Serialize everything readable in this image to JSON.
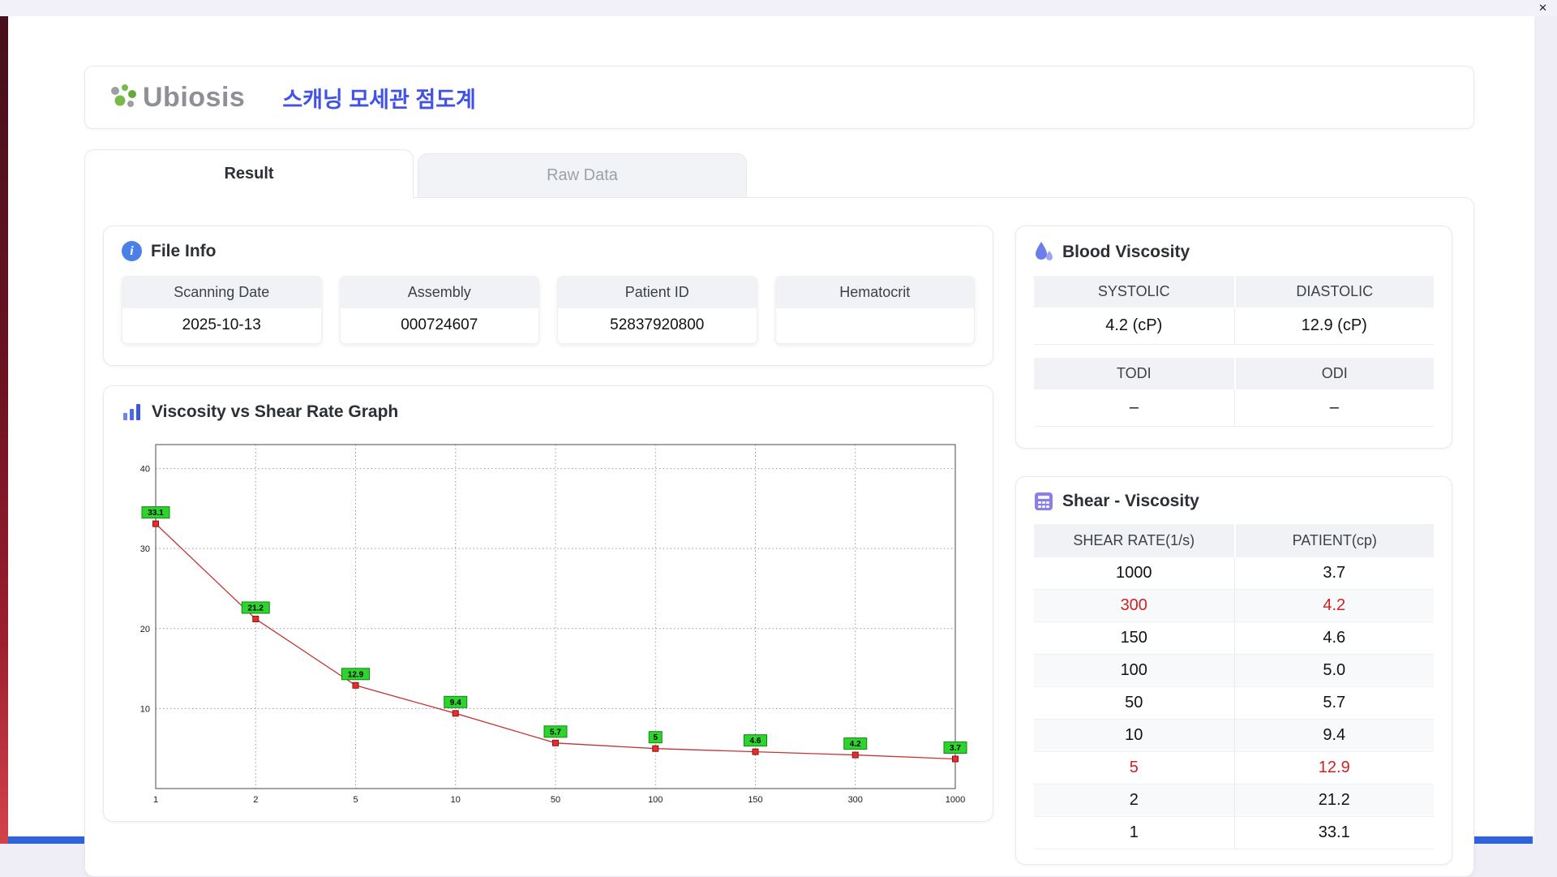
{
  "window": {
    "close_label": "✕"
  },
  "header": {
    "logo_text": "Ubiosis",
    "app_title": "스캐닝 모세관 점도계"
  },
  "tabs": {
    "result": "Result",
    "raw_data": "Raw Data"
  },
  "file_info": {
    "heading": "File Info",
    "fields": [
      {
        "label": "Scanning Date",
        "value": "2025-10-13"
      },
      {
        "label": "Assembly",
        "value": "000724607"
      },
      {
        "label": "Patient ID",
        "value": "52837920800"
      },
      {
        "label": "Hematocrit",
        "value": ""
      }
    ]
  },
  "blood_viscosity": {
    "heading": "Blood Viscosity",
    "groups": [
      {
        "left_label": "SYSTOLIC",
        "right_label": "DIASTOLIC",
        "left_value": "4.2 (cP)",
        "right_value": "12.9 (cP)"
      },
      {
        "left_label": "TODI",
        "right_label": "ODI",
        "left_value": "–",
        "right_value": "–"
      }
    ]
  },
  "shear_viscosity": {
    "heading": "Shear - Viscosity",
    "columns": [
      "SHEAR RATE(1/s)",
      "PATIENT(cp)"
    ],
    "rows": [
      {
        "shear_rate": "1000",
        "patient": "3.7",
        "highlight": false
      },
      {
        "shear_rate": "300",
        "patient": "4.2",
        "highlight": true
      },
      {
        "shear_rate": "150",
        "patient": "4.6",
        "highlight": false
      },
      {
        "shear_rate": "100",
        "patient": "5.0",
        "highlight": false
      },
      {
        "shear_rate": "50",
        "patient": "5.7",
        "highlight": false
      },
      {
        "shear_rate": "10",
        "patient": "9.4",
        "highlight": false
      },
      {
        "shear_rate": "5",
        "patient": "12.9",
        "highlight": true
      },
      {
        "shear_rate": "2",
        "patient": "21.2",
        "highlight": false
      },
      {
        "shear_rate": "1",
        "patient": "33.1",
        "highlight": false
      }
    ]
  },
  "chart_data": {
    "type": "line",
    "title": "Viscosity vs Shear Rate Graph",
    "x": [
      1,
      2,
      5,
      10,
      50,
      100,
      150,
      300,
      1000
    ],
    "x_tick_labels": [
      "1",
      "2",
      "5",
      "10",
      "50",
      "100",
      "150",
      "300",
      "1000"
    ],
    "values": [
      33.1,
      21.2,
      12.9,
      9.4,
      5.7,
      5,
      4.6,
      4.2,
      3.7
    ],
    "point_labels": [
      "33.1",
      "21.2",
      "12.9",
      "9.4",
      "5.7",
      "5",
      "4.6",
      "4.2",
      "3.7"
    ],
    "xlabel": "",
    "ylabel": "",
    "y_ticks": [
      10,
      20,
      30,
      40
    ],
    "ylim": [
      0,
      43
    ],
    "x_axis_scale": "categorical-log-spaced",
    "grid": true,
    "legend": "none",
    "line_color": "#c53333",
    "marker_color": "#e62e2e",
    "point_label_bg": "#2fd32f"
  }
}
